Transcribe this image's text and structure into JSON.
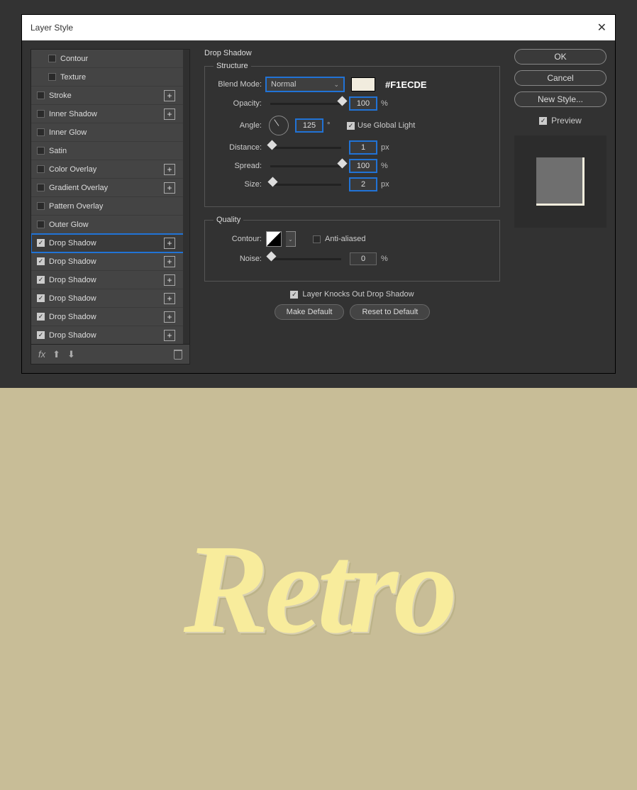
{
  "dialog": {
    "title": "Layer Style"
  },
  "effects": {
    "items": [
      {
        "label": "Contour",
        "checked": false,
        "indent": true,
        "plus": false
      },
      {
        "label": "Texture",
        "checked": false,
        "indent": true,
        "plus": false
      },
      {
        "label": "Stroke",
        "checked": false,
        "indent": false,
        "plus": true
      },
      {
        "label": "Inner Shadow",
        "checked": false,
        "indent": false,
        "plus": true
      },
      {
        "label": "Inner Glow",
        "checked": false,
        "indent": false,
        "plus": false
      },
      {
        "label": "Satin",
        "checked": false,
        "indent": false,
        "plus": false
      },
      {
        "label": "Color Overlay",
        "checked": false,
        "indent": false,
        "plus": true
      },
      {
        "label": "Gradient Overlay",
        "checked": false,
        "indent": false,
        "plus": true
      },
      {
        "label": "Pattern Overlay",
        "checked": false,
        "indent": false,
        "plus": false
      },
      {
        "label": "Outer Glow",
        "checked": false,
        "indent": false,
        "plus": false
      },
      {
        "label": "Drop Shadow",
        "checked": true,
        "indent": false,
        "plus": true,
        "selected": true
      },
      {
        "label": "Drop Shadow",
        "checked": true,
        "indent": false,
        "plus": true
      },
      {
        "label": "Drop Shadow",
        "checked": true,
        "indent": false,
        "plus": true
      },
      {
        "label": "Drop Shadow",
        "checked": true,
        "indent": false,
        "plus": true
      },
      {
        "label": "Drop Shadow",
        "checked": true,
        "indent": false,
        "plus": true
      },
      {
        "label": "Drop Shadow",
        "checked": true,
        "indent": false,
        "plus": true
      }
    ]
  },
  "settings": {
    "heading": "Drop Shadow",
    "structure": {
      "legend": "Structure",
      "blend_mode_label": "Blend Mode:",
      "blend_mode_value": "Normal",
      "color_hex": "#F1ECDE",
      "opacity_label": "Opacity:",
      "opacity_value": "100",
      "opacity_unit": "%",
      "angle_label": "Angle:",
      "angle_value": "125",
      "angle_unit": "°",
      "global_light_label": "Use Global Light",
      "distance_label": "Distance:",
      "distance_value": "1",
      "distance_unit": "px",
      "spread_label": "Spread:",
      "spread_value": "100",
      "spread_unit": "%",
      "size_label": "Size:",
      "size_value": "2",
      "size_unit": "px"
    },
    "quality": {
      "legend": "Quality",
      "contour_label": "Contour:",
      "anti_aliased_label": "Anti-aliased",
      "noise_label": "Noise:",
      "noise_value": "0",
      "noise_unit": "%"
    },
    "knockout_label": "Layer Knocks Out Drop Shadow",
    "make_default": "Make Default",
    "reset_default": "Reset to Default"
  },
  "actions": {
    "ok": "OK",
    "cancel": "Cancel",
    "new_style": "New Style...",
    "preview": "Preview"
  },
  "canvas": {
    "text": "Retro"
  }
}
